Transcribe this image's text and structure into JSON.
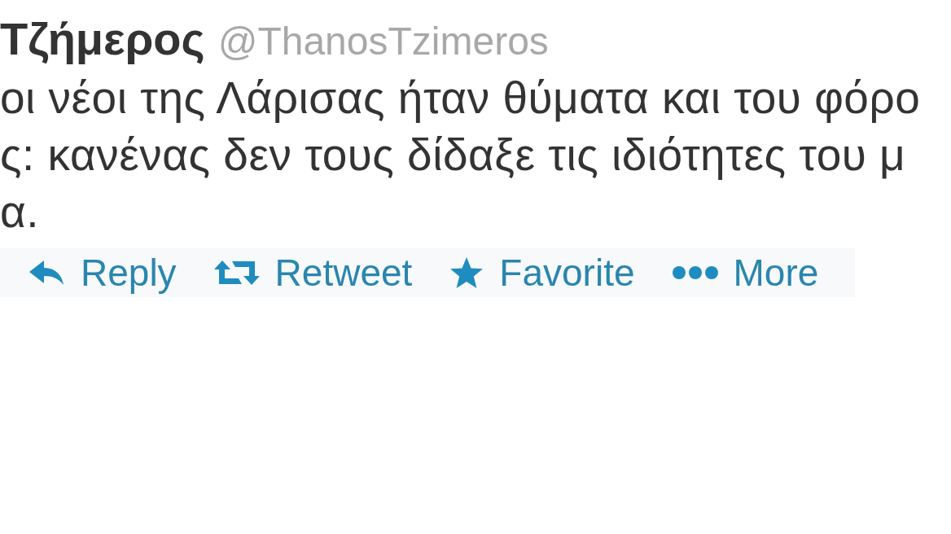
{
  "tweet": {
    "author_name": "Τζήμερος",
    "handle": "@ThanosTzimeros",
    "text_lines": [
      "οι νέοι της Λάρισας ήταν θύματα και του φόρο",
      "ς: κανένας δεν τους δίδαξε τις ιδιότητες του μ",
      "α."
    ],
    "actions": [
      {
        "kind": "reply",
        "label": "Reply"
      },
      {
        "kind": "retweet",
        "label": "Retweet"
      },
      {
        "kind": "favorite",
        "label": "Favorite"
      },
      {
        "kind": "more",
        "label": "More"
      }
    ]
  }
}
